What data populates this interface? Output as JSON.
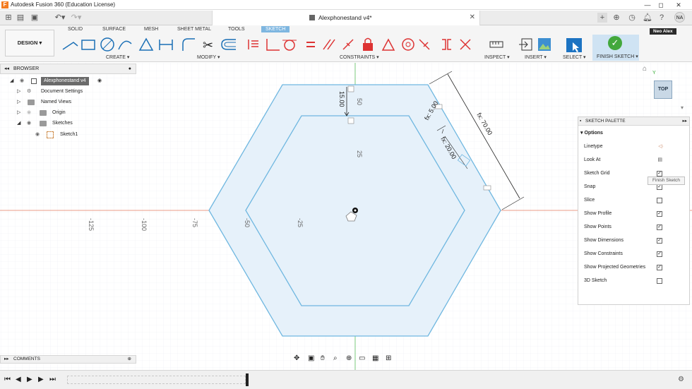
{
  "app": {
    "title": "Autodesk Fusion 360 (Education License)"
  },
  "window_controls": {
    "minimize": "—",
    "maximize": "◻",
    "close": "✕"
  },
  "document": {
    "name": "Alexphonestand v4*",
    "close": "✕"
  },
  "user": {
    "initials": "NA",
    "name": "Neo Alex"
  },
  "workspace": {
    "label": "DESIGN ▾"
  },
  "ribbon_tabs": [
    "SOLID",
    "SURFACE",
    "MESH",
    "SHEET METAL",
    "TOOLS",
    "SKETCH"
  ],
  "groups": {
    "create": "CREATE ▾",
    "modify": "MODIFY ▾",
    "constraints": "CONSTRAINTS ▾",
    "inspect": "INSPECT ▾",
    "insert": "INSERT ▾",
    "select": "SELECT ▾",
    "finish": "FINISH SKETCH ▾"
  },
  "browser": {
    "title": "BROWSER",
    "items": [
      {
        "label": "Alexphonestand v4"
      },
      {
        "label": "Document Settings"
      },
      {
        "label": "Named Views"
      },
      {
        "label": "Origin"
      },
      {
        "label": "Sketches"
      },
      {
        "label": "Sketch1"
      }
    ]
  },
  "comments": {
    "title": "COMMENTS"
  },
  "viewcube": {
    "face": "TOP",
    "axis": "Y"
  },
  "sketch": {
    "axis_labels": [
      "-125",
      "-100",
      "-75",
      "-50",
      "-25",
      "50",
      "25"
    ],
    "dimensions": {
      "d1": "15.00",
      "d2": "fx: 70.00",
      "d3": "fx: 5.00",
      "d4": "fx: 20.00"
    }
  },
  "palette": {
    "title": "SKETCH PALETTE",
    "section": "Options",
    "rows": [
      {
        "label": "Linetype",
        "type": "icon"
      },
      {
        "label": "Look At",
        "type": "icon"
      },
      {
        "label": "Sketch Grid",
        "checked": true
      },
      {
        "label": "Snap",
        "checked": true
      },
      {
        "label": "Slice",
        "checked": false
      },
      {
        "label": "Show Profile",
        "checked": true
      },
      {
        "label": "Show Points",
        "checked": true
      },
      {
        "label": "Show Dimensions",
        "checked": true
      },
      {
        "label": "Show Constraints",
        "checked": true
      },
      {
        "label": "Show Projected Geometries",
        "checked": true
      },
      {
        "label": "3D Sketch",
        "checked": false
      }
    ],
    "finish_button": "Finish Sketch"
  },
  "colors": {
    "accent": "#7eb6e0",
    "finish_bg": "#cfe3f3",
    "check": "#43a83c",
    "sketch_line": "#6fb7e0",
    "profile_fill": "#e6f1fa",
    "x_axis": "#e07a5f",
    "y_axis": "#5cbf5c"
  }
}
